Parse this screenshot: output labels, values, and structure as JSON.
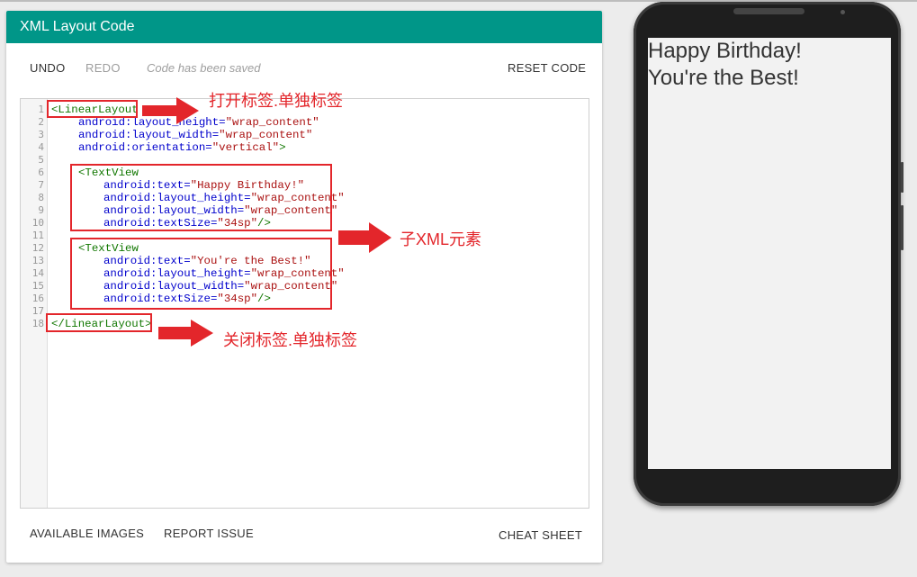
{
  "header": {
    "title": "XML Layout Code"
  },
  "toolbar": {
    "undo": "UNDO",
    "redo": "REDO",
    "status": "Code has been saved",
    "reset": "RESET CODE"
  },
  "editor": {
    "line_numbers": [
      "1",
      "2",
      "3",
      "4",
      "5",
      "6",
      "7",
      "8",
      "9",
      "10",
      "11",
      "12",
      "13",
      "14",
      "15",
      "16",
      "17",
      "18"
    ],
    "lines": {
      "l1_tag": "<LinearLayout",
      "l2_attr": "android:layout_height=",
      "l2_val": "\"wrap_content\"",
      "l3_attr": "android:layout_width=",
      "l3_val": "\"wrap_content\"",
      "l4_attr": "android:orientation=",
      "l4_val": "\"vertical\"",
      "l4_end": ">",
      "l6_tag": "<TextView",
      "l7_attr": "android:text=",
      "l7_val": "\"Happy Birthday!\"",
      "l8_attr": "android:layout_height=",
      "l8_val": "\"wrap_content\"",
      "l9_attr": "android:layout_width=",
      "l9_val": "\"wrap_content\"",
      "l10_attr": "android:textSize=",
      "l10_val": "\"34sp\"",
      "l10_end": "/>",
      "l12_tag": "<TextView",
      "l13_attr": "android:text=",
      "l13_val": "\"You're the Best!\"",
      "l14_attr": "android:layout_height=",
      "l14_val": "\"wrap_content\"",
      "l15_attr": "android:layout_width=",
      "l15_val": "\"wrap_content\"",
      "l16_attr": "android:textSize=",
      "l16_val": "\"34sp\"",
      "l16_end": "/>",
      "l18_tag": "</LinearLayout>"
    }
  },
  "annotations": {
    "open_tag": "打开标签.单独标签",
    "child_elements": "子XML元素",
    "close_tag": "关闭标签.单独标签"
  },
  "footer": {
    "images": "AVAILABLE IMAGES",
    "report": "REPORT ISSUE",
    "cheat": "CHEAT SHEET"
  },
  "preview": {
    "line1": "Happy Birthday!",
    "line2": "You're the Best!"
  },
  "colors": {
    "header": "#009688",
    "annotation": "#e3262b"
  },
  "icons": {
    "arrow": "right-arrow-icon"
  }
}
